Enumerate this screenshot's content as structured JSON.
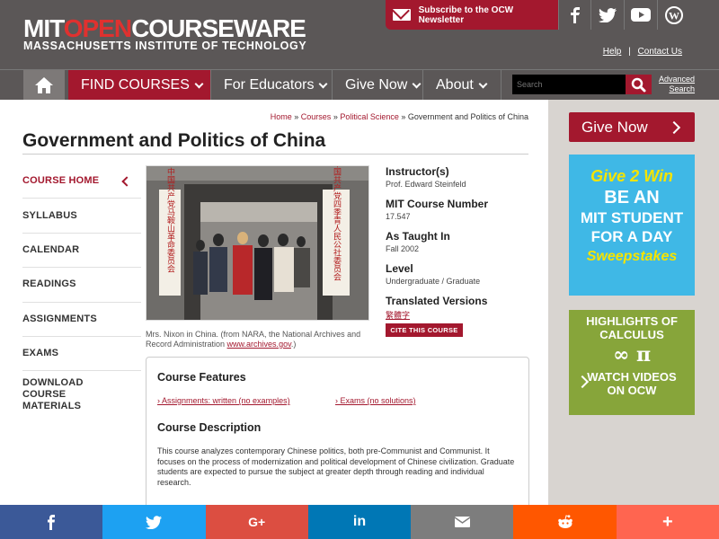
{
  "header": {
    "logo_part1": "MIT",
    "logo_part2": "OPEN",
    "logo_part3": "COURSEWARE",
    "subtitle": "MASSACHUSETTS INSTITUTE OF TECHNOLOGY",
    "newsletter_label": "Subscribe to the OCW Newsletter",
    "social_icons": [
      "facebook-icon",
      "twitter-icon",
      "youtube-icon",
      "wordpress-icon"
    ],
    "help_link": "Help",
    "contact_link": "Contact Us",
    "separator": "|"
  },
  "nav": {
    "find_courses": "FIND COURSES",
    "for_educators": "For Educators",
    "give_now": "Give Now",
    "about": "About",
    "search_placeholder": "Search",
    "advanced_search_line1": "Advanced",
    "advanced_search_line2": "Search"
  },
  "breadcrumb": {
    "home": "Home",
    "courses": "Courses",
    "department": "Political Science",
    "current": "Government and Politics of China",
    "sep": "»"
  },
  "page_title": "Government and Politics of China",
  "sidebar": {
    "items": [
      {
        "label": "COURSE HOME"
      },
      {
        "label": "SYLLABUS"
      },
      {
        "label": "CALENDAR"
      },
      {
        "label": "READINGS"
      },
      {
        "label": "ASSIGNMENTS"
      },
      {
        "label": "EXAMS"
      },
      {
        "label": "DOWNLOAD COURSE MATERIALS"
      }
    ]
  },
  "photo": {
    "caption_text": "Mrs. Nixon in China. (from NARA, the National Archives and Record Administration ",
    "caption_link": "www.archives.gov",
    "caption_end": ".)",
    "sign_left": "中国共产党马鞍山革命委员会",
    "sign_right": "中国共产党四季青人民公社委员会"
  },
  "info": {
    "instructor_label": "Instructor(s)",
    "instructor_value": "Prof. Edward Steinfeld",
    "course_number_label": "MIT Course Number",
    "course_number_value": "17.547",
    "taught_label": "As Taught In",
    "taught_value": "Fall 2002",
    "level_label": "Level",
    "level_value": "Undergraduate / Graduate",
    "translated_label": "Translated Versions",
    "translated_value": "繁體字",
    "cite_button": "CITE THIS COURSE"
  },
  "features": {
    "title": "Course Features",
    "feature1": "Assignments: written (no examples)",
    "feature2": "Exams (no solutions)",
    "desc_title": "Course Description",
    "description": "This course analyzes contemporary Chinese politics, both pre-Communist and Communist. It focuses on the process of modernization and political development of Chinese civilization. Graduate students are expected to pursue the subject at greater depth through reading and individual research."
  },
  "right_rail": {
    "give_now": "Give Now",
    "promo1_line1": "Give 2 Win",
    "promo1_line2": "BE AN",
    "promo1_line3": "MIT STUDENT",
    "promo1_line4": "FOR A DAY",
    "promo1_line5": "Sweepstakes",
    "promo2_line1": "HIGHLIGHTS OF",
    "promo2_line2": "CALCULUS",
    "promo2_line3": "WATCH VIDEOS",
    "promo2_line4": "ON OCW"
  },
  "share_bar": {
    "items": [
      {
        "icon": "facebook-icon",
        "glyph": "f",
        "color": "#3b5998"
      },
      {
        "icon": "twitter-icon",
        "glyph": "🐦",
        "color": "#1da1f2"
      },
      {
        "icon": "google-plus-icon",
        "glyph": "G+",
        "color": "#dc4e41"
      },
      {
        "icon": "linkedin-icon",
        "glyph": "in",
        "color": "#0077b5"
      },
      {
        "icon": "email-icon",
        "glyph": "✉",
        "color": "#7d7d7d"
      },
      {
        "icon": "reddit-icon",
        "glyph": "👽",
        "color": "#ff5700"
      },
      {
        "icon": "more-icon",
        "glyph": "+",
        "color": "#ff6550"
      }
    ]
  },
  "colors": {
    "brand_red": "#a3182e",
    "header_gray": "#5b5757",
    "promo_blue": "#3fb8e6",
    "promo_green": "#87a53a"
  }
}
